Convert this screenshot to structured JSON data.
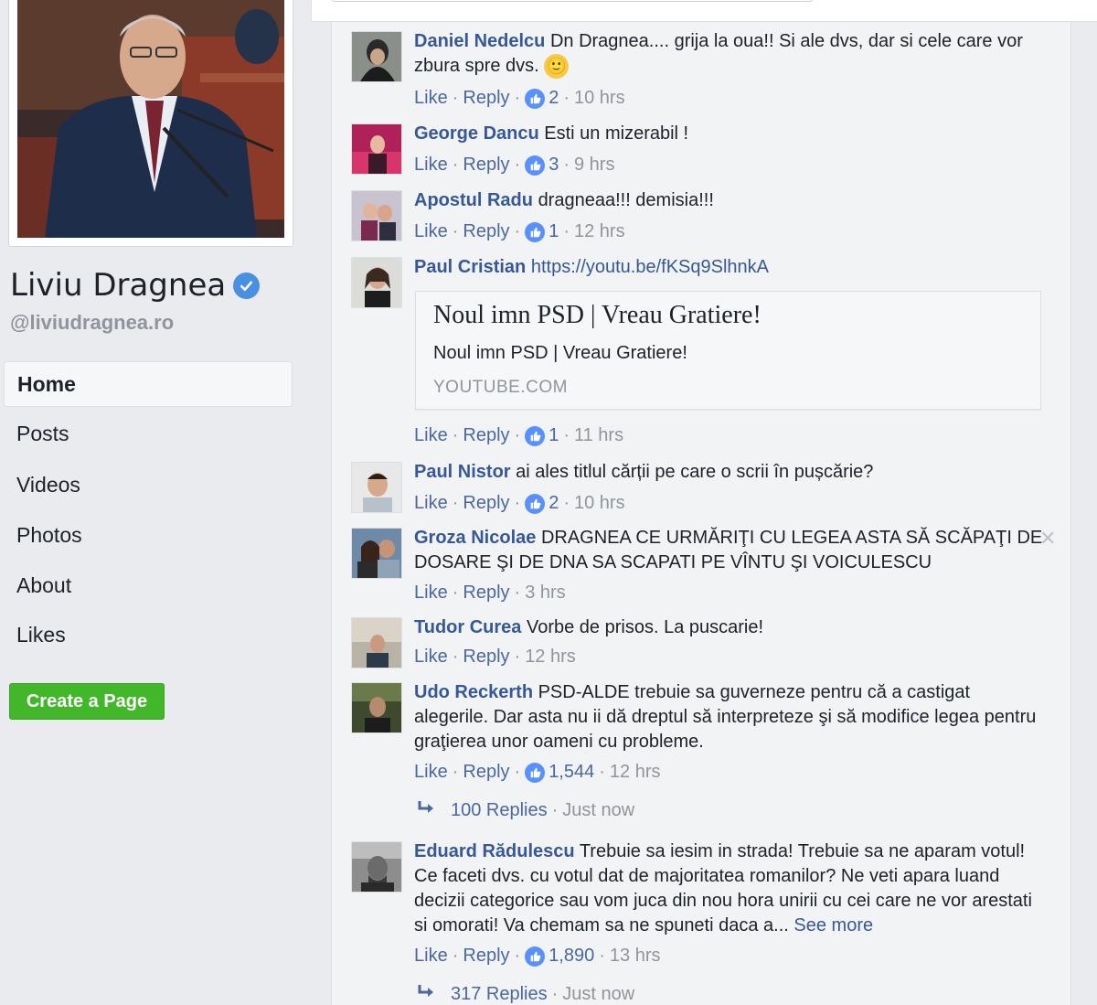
{
  "sidebar": {
    "page_name": "Liviu Dragnea",
    "handle": "@liviudragnea.ro",
    "nav": [
      {
        "label": "Home",
        "active": true
      },
      {
        "label": "Posts"
      },
      {
        "label": "Videos"
      },
      {
        "label": "Photos"
      },
      {
        "label": "About"
      },
      {
        "label": "Likes"
      }
    ],
    "create_page": "Create a Page"
  },
  "actions": {
    "like": "Like",
    "reply": "Reply",
    "dot": "·"
  },
  "comments": [
    {
      "author": "Daniel Nedelcu",
      "text": "Dn Dragnea.... grija la oua!! Si ale dvs, dar si cele care vor zbura spre dvs.",
      "emoji": "🙂",
      "likes": "2",
      "time": "10 hrs"
    },
    {
      "author": "George Dancu",
      "text": "Esti un mizerabil !",
      "likes": "3",
      "time": "9 hrs"
    },
    {
      "author": "Apostul Radu",
      "text": "dragneaa!!! demisia!!!",
      "likes": "1",
      "time": "12 hrs"
    },
    {
      "author": "Paul Cristian",
      "link": "https://youtu.be/fKSq9SlhnkA",
      "embed": {
        "title": "Noul imn PSD | Vreau Gratiere!",
        "description": "Noul imn PSD | Vreau Gratiere!",
        "domain": "YOUTUBE.COM"
      },
      "likes": "1",
      "time": "11 hrs"
    },
    {
      "author": "Paul Nistor",
      "text": "ai ales titlul cărții pe care o scrii în pușcărie?",
      "likes": "2",
      "time": "10 hrs"
    },
    {
      "author": "Groza Nicolae",
      "text": "DRAGNEA CE URMĂRIŢI CU LEGEA ASTA SĂ SCĂPAŢI DE DOSARE ŞI DE DNA SA SCAPATI PE VÎNTU ŞI VOICULESCU",
      "time": "3 hrs",
      "close": "✕"
    },
    {
      "author": "Tudor Curea",
      "text": "Vorbe de prisos. La puscarie!",
      "time": "12 hrs"
    },
    {
      "author": "Udo Reckerth",
      "text": "PSD-ALDE trebuie sa guverneze pentru că a castigat alegerile. Dar asta nu ii dă dreptul să interpreteze şi să modifice legea pentru graţierea unor oameni cu probleme.",
      "likes": "1,544",
      "time": "12 hrs",
      "replies": "100 Replies",
      "replies_time": "Just now"
    },
    {
      "author": "Eduard Rădulescu",
      "text": "Trebuie sa iesim in strada! Trebuie sa ne aparam votul! Ce faceti dvs. cu votul dat de majoritatea romanilor? Ne veti apara luand decizii categorice sau vom juca din nou hora unirii cu cei care ne vor arestati si omorati! Va chemam sa ne spuneti daca a...",
      "see_more": "See more",
      "likes": "1,890",
      "time": "13 hrs",
      "replies": "317 Replies",
      "replies_time": "Just now"
    }
  ],
  "colors": {
    "link": "#365899",
    "meta": "#90949c",
    "like_badge": "#5890ff",
    "create_button": "#42b72a"
  }
}
